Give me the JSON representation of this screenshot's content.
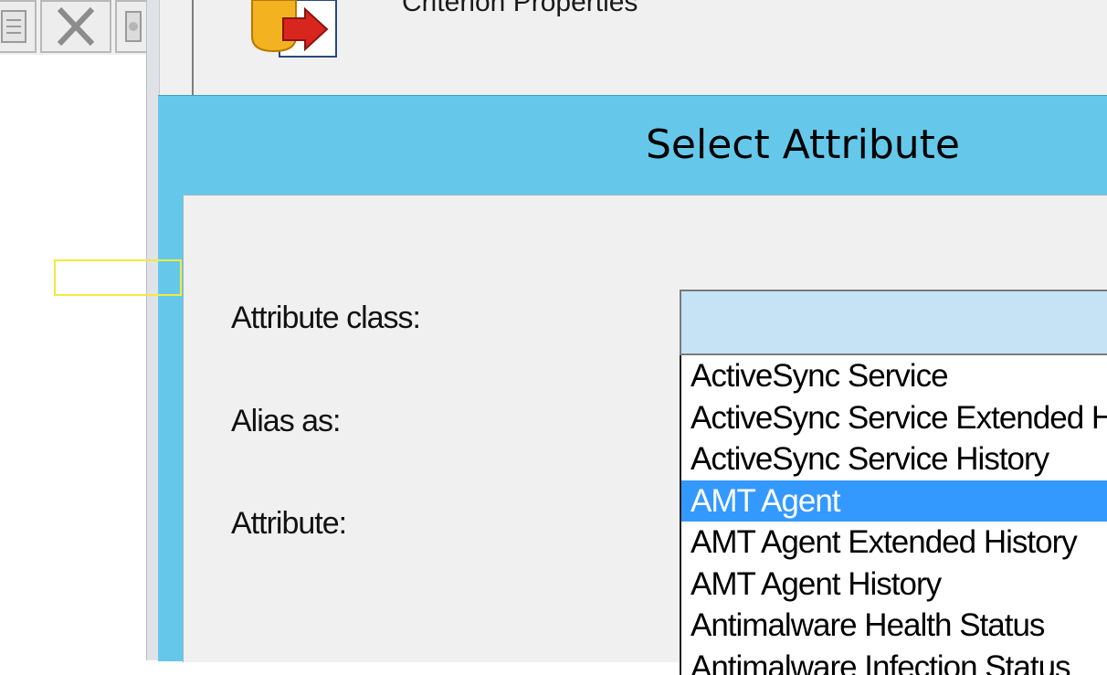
{
  "background_window": {
    "title": "Criterion Properties",
    "icon": "criterion-properties-icon"
  },
  "toolbar": {
    "buttons": [
      {
        "icon": "properties-icon"
      },
      {
        "icon": "delete-x-icon"
      },
      {
        "icon": "tool-icon"
      }
    ]
  },
  "dialog": {
    "title": "Select Attribute",
    "labels": {
      "attribute_class": "Attribute class:",
      "alias_as": "Alias as:",
      "attribute": "Attribute:"
    },
    "attribute_class_value": "",
    "dropdown_items": [
      "ActiveSync Service",
      "ActiveSync Service Extended History",
      "ActiveSync Service History",
      "AMT Agent",
      "AMT Agent Extended History",
      "AMT Agent History",
      "Antimalware Health Status",
      "Antimalware Infection Status"
    ],
    "selected_item": "AMT Agent"
  },
  "colors": {
    "dialog_title_bar": "#65c8ea",
    "selection": "#3399ff",
    "combo_fill": "#c6e3f5",
    "highlight_box": "#f2ea3f"
  }
}
